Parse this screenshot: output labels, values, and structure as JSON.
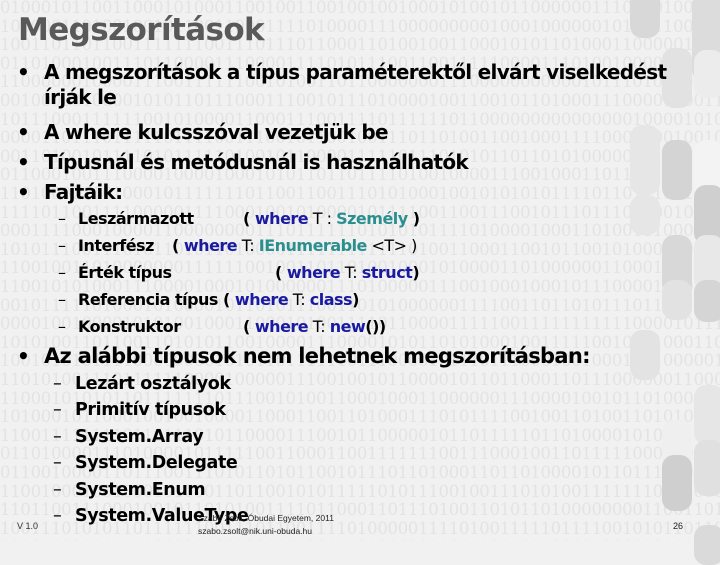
{
  "slide": {
    "title": "Megszorítások",
    "bullets": [
      "A megszorítások a típus paraméterektől elvárt viselkedést írják le",
      "A where kulcsszóval vezetjük be",
      "Típusnál és metódusnál is használhatók",
      "Fajtáik:"
    ],
    "kinds": [
      {
        "label": "Leszármazott",
        "open": "( ",
        "keyword": "where",
        "param": " T : ",
        "type": "Személy",
        "tail": " )"
      },
      {
        "label": "Interfész",
        "open": "( ",
        "keyword": "where",
        "param": " T: ",
        "type": "IEnumerable",
        "tail": " <T>  )"
      },
      {
        "label": "Érték típus",
        "open": "( ",
        "keyword": "where",
        "param": " T: ",
        "type": "struct",
        "tail": ")"
      },
      {
        "label": "Referencia típus",
        "open": " ( ",
        "keyword": "where",
        "param": " T: ",
        "type": "class",
        "tail": ")"
      },
      {
        "label": "Konstruktor",
        "open": "( ",
        "keyword": "where",
        "param": " T: ",
        "type": "new",
        "tail": "())"
      }
    ],
    "second_bullet": "Az alábbi típusok nem lehetnek megszorításban:",
    "excluded": [
      "Lezárt osztályok",
      "Primitív típusok",
      "System.Array",
      "System.Delegate",
      "System.Enum",
      "System.ValueType"
    ],
    "bullet_glyph": "•",
    "dash_glyph": "–"
  },
  "footer": {
    "version": "V 1.0",
    "author_line1": "Szabó Zsolt, Óbudai Egyetem, 2011",
    "author_line2": "szabo.zsolt@nik.uni-obuda.hu",
    "page_number": "26"
  },
  "colors": {
    "title": "#595959",
    "keyword": "#1a1aa0",
    "type": "#2b8f8f",
    "background": "#f1f1f1"
  }
}
